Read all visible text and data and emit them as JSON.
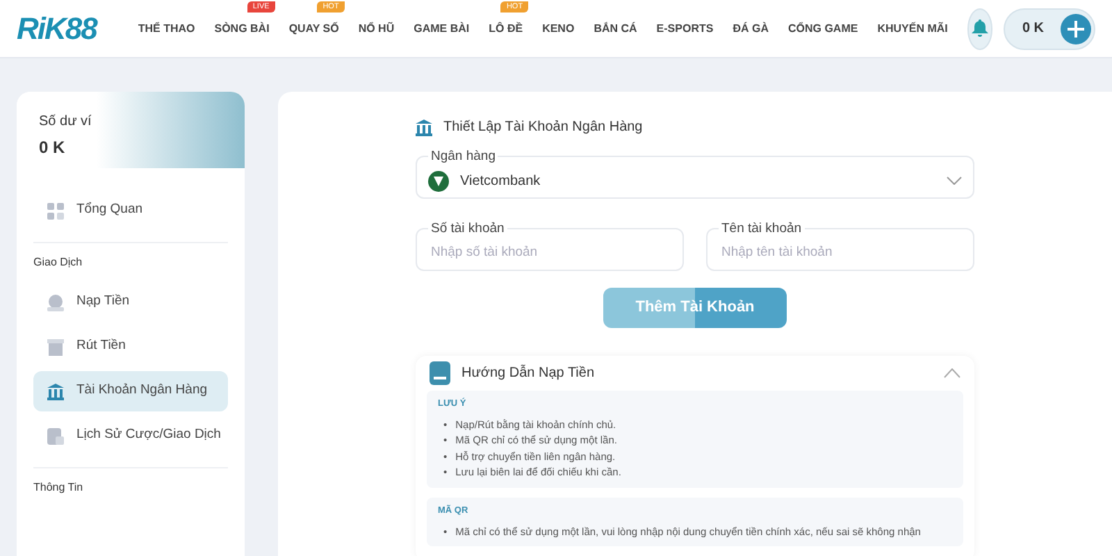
{
  "header": {
    "logo": "RiK88",
    "nav": [
      {
        "label": "THỂ THAO"
      },
      {
        "label": "SÒNG BÀI",
        "badge": {
          "text": "LIVE",
          "color": "#e8453c"
        }
      },
      {
        "label": "QUAY SỐ",
        "badge": {
          "text": "HOT",
          "color": "#f0a030"
        }
      },
      {
        "label": "NỔ HŨ"
      },
      {
        "label": "GAME BÀI"
      },
      {
        "label": "LÔ ĐỀ",
        "badge": {
          "text": "HOT",
          "color": "#f0a030"
        }
      },
      {
        "label": "KENO"
      },
      {
        "label": "BẮN CÁ"
      },
      {
        "label": "E-SPORTS"
      },
      {
        "label": "ĐÁ GÀ"
      },
      {
        "label": "CỔNG GAME"
      },
      {
        "label": "KHUYẾN MÃI"
      }
    ],
    "balance": "0 K"
  },
  "sidebar": {
    "wallet_label": "Số dư ví",
    "wallet_amount": "0 K",
    "sections": [
      {
        "items": [
          {
            "label": "Tổng Quan",
            "selected": false
          }
        ]
      },
      {
        "title": "Giao Dịch",
        "items": [
          {
            "label": "Nạp Tiền",
            "selected": false
          },
          {
            "label": "Rút Tiền",
            "selected": false
          },
          {
            "label": "Tài Khoản Ngân Hàng",
            "selected": true
          },
          {
            "label": "Lịch Sử Cược/Giao Dịch",
            "selected": false
          }
        ]
      },
      {
        "title": "Thông Tin"
      }
    ]
  },
  "form": {
    "title": "Thiết Lập Tài Khoản Ngân Hàng",
    "bank_label": "Ngân hàng",
    "bank_value": "Vietcombank",
    "fields": [
      {
        "label": "Số tài khoản",
        "placeholder": "Nhập số tài khoản"
      },
      {
        "label": "Tên tài khoản",
        "placeholder": "Nhập tên tài khoản"
      }
    ],
    "submit": "Thêm Tài Khoản"
  },
  "guide": {
    "title": "Hướng Dẫn Nạp Tiền",
    "expanded": true,
    "blocks": [
      {
        "heading": "LƯU Ý",
        "bullet": "•",
        "items": [
          "Nạp/Rút bằng tài khoản chính chủ.",
          "Mã QR chỉ có thể sử dụng một lần.",
          "Hỗ trợ chuyển tiền liên ngân hàng.",
          "Lưu lại biên lai để đối chiếu khi cần."
        ]
      },
      {
        "heading": "MÃ QR",
        "bullet": "•",
        "items": [
          "Mã chỉ có thể sử dụng một lần, vui lòng nhập nội dung chuyển tiền chính xác, nếu sai sẽ không nhận"
        ]
      }
    ]
  }
}
